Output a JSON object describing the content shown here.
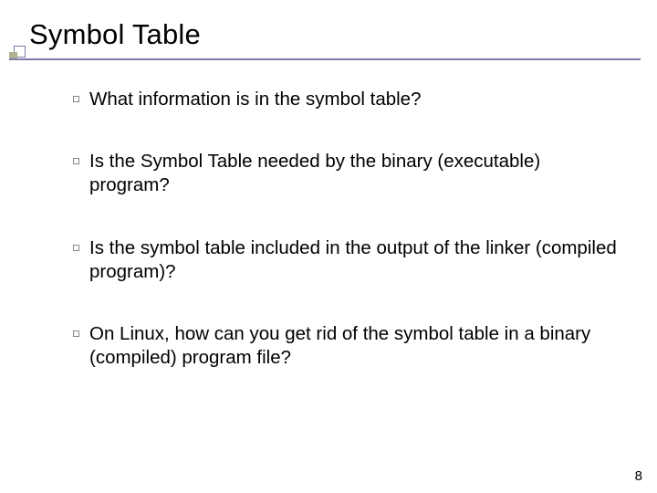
{
  "title": "Symbol Table",
  "bullets": [
    "What information is in the symbol table?",
    "Is the Symbol Table needed by the binary (executable) program?",
    "Is the symbol table included in the output of the linker (compiled program)?",
    "On Linux, how can you get rid of the symbol table in a binary (compiled) program file?"
  ],
  "page_number": "8"
}
